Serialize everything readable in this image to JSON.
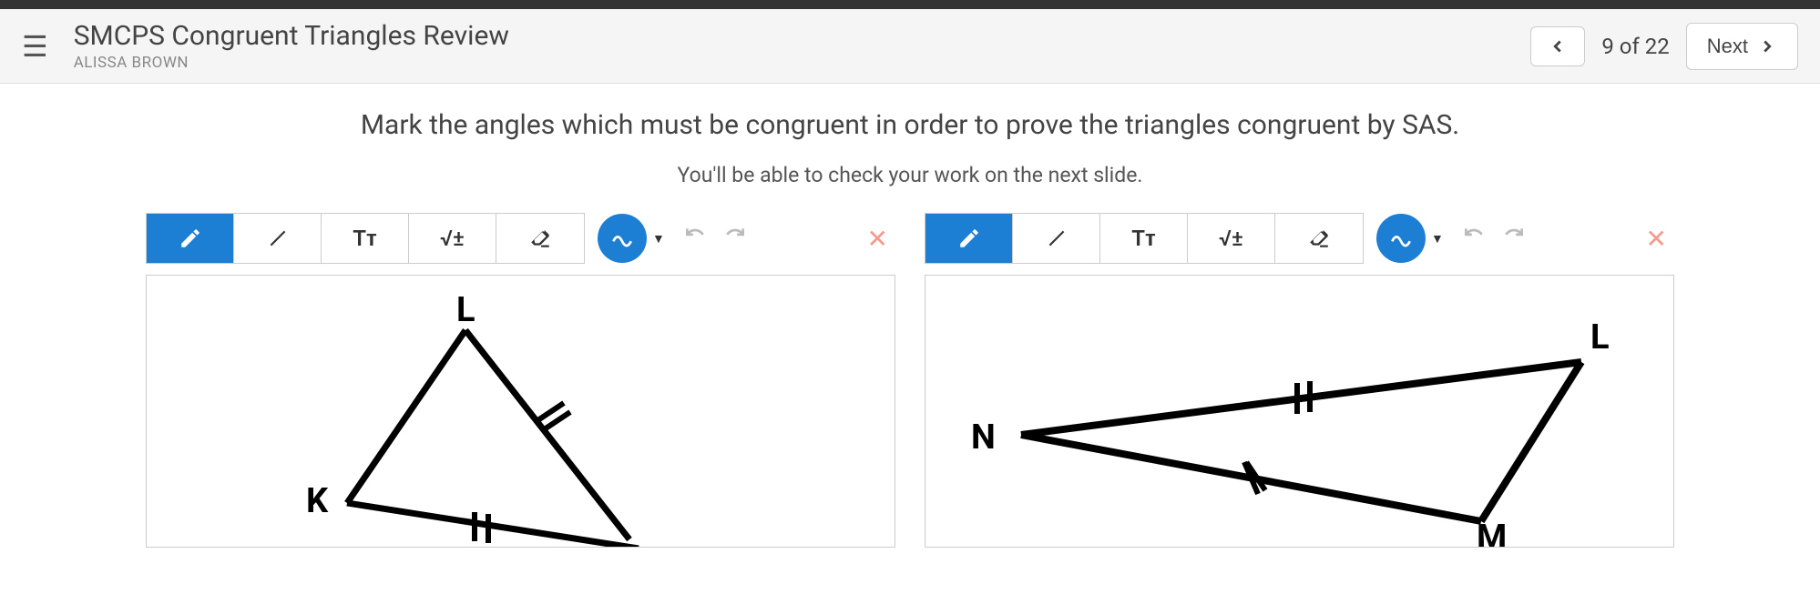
{
  "header": {
    "title": "SMCPS Congruent Triangles Review",
    "author": "ALISSA BROWN",
    "page_indicator": "9 of 22",
    "next_label": "Next"
  },
  "content": {
    "question": "Mark the angles which must be congruent in order to prove the triangles congruent by SAS.",
    "hint": "You'll be able to check your work on the next slide."
  },
  "toolbar": {
    "pencil": "pencil",
    "line": "line",
    "text": "Tᴛ",
    "math": "√±",
    "eraser": "eraser",
    "scribble": "scribble",
    "undo": "undo",
    "redo": "redo",
    "close": "✕"
  },
  "triangles": {
    "left": {
      "labels": [
        "L",
        "K"
      ]
    },
    "right": {
      "labels": [
        "L",
        "N",
        "M"
      ]
    }
  },
  "colors": {
    "accent": "#1d7fd4",
    "close": "#f59a8e"
  }
}
